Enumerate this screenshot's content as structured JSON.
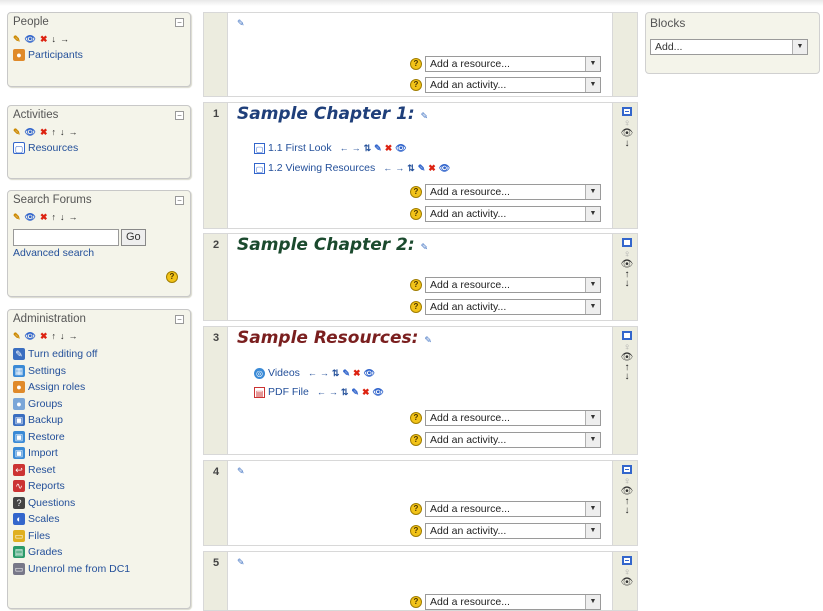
{
  "colors": {
    "block_bg": "#f4f4ea",
    "link": "#24509a",
    "chapter_title": "#1f3f7a",
    "chapter2_title": "#1b4a2e",
    "resources_title": "#7a1f1f",
    "delete_red": "#d21"
  },
  "people": {
    "title": "People",
    "collapse": "−",
    "participants": "Participants"
  },
  "activities": {
    "title": "Activities",
    "collapse": "−",
    "resources": "Resources"
  },
  "search_forums": {
    "title": "Search Forums",
    "collapse": "−",
    "input_value": "",
    "go_label": "Go",
    "advanced": "Advanced search",
    "help": "?"
  },
  "administration": {
    "title": "Administration",
    "collapse": "−",
    "items": [
      {
        "label": "Turn editing off",
        "icon": "edit-icon"
      },
      {
        "label": "Settings",
        "icon": "settings-icon"
      },
      {
        "label": "Assign roles",
        "icon": "roles-icon"
      },
      {
        "label": "Groups",
        "icon": "groups-icon"
      },
      {
        "label": "Backup",
        "icon": "backup-icon"
      },
      {
        "label": "Restore",
        "icon": "restore-icon"
      },
      {
        "label": "Import",
        "icon": "import-icon"
      },
      {
        "label": "Reset",
        "icon": "reset-icon"
      },
      {
        "label": "Reports",
        "icon": "reports-icon"
      },
      {
        "label": "Questions",
        "icon": "questions-icon"
      },
      {
        "label": "Scales",
        "icon": "scales-icon"
      },
      {
        "label": "Files",
        "icon": "files-icon"
      },
      {
        "label": "Grades",
        "icon": "grades-icon"
      },
      {
        "label": "Unenrol me from DC1",
        "icon": "unenrol-icon"
      }
    ]
  },
  "selects": {
    "add_resource": "Add a resource...",
    "add_activity": "Add an activity...",
    "help": "?"
  },
  "sections": [
    {
      "number": "",
      "title": ""
    },
    {
      "number": "1",
      "title": "Sample Chapter 1:",
      "activities": [
        "1.1 First Look",
        "1.2 Viewing Resources"
      ]
    },
    {
      "number": "2",
      "title": "Sample Chapter 2:"
    },
    {
      "number": "3",
      "title": "Sample Resources:",
      "activities": [
        "Videos",
        "PDF File"
      ]
    },
    {
      "number": "4",
      "title": ""
    },
    {
      "number": "5",
      "title": ""
    }
  ],
  "blocks": {
    "title": "Blocks",
    "select_value": "Add..."
  }
}
